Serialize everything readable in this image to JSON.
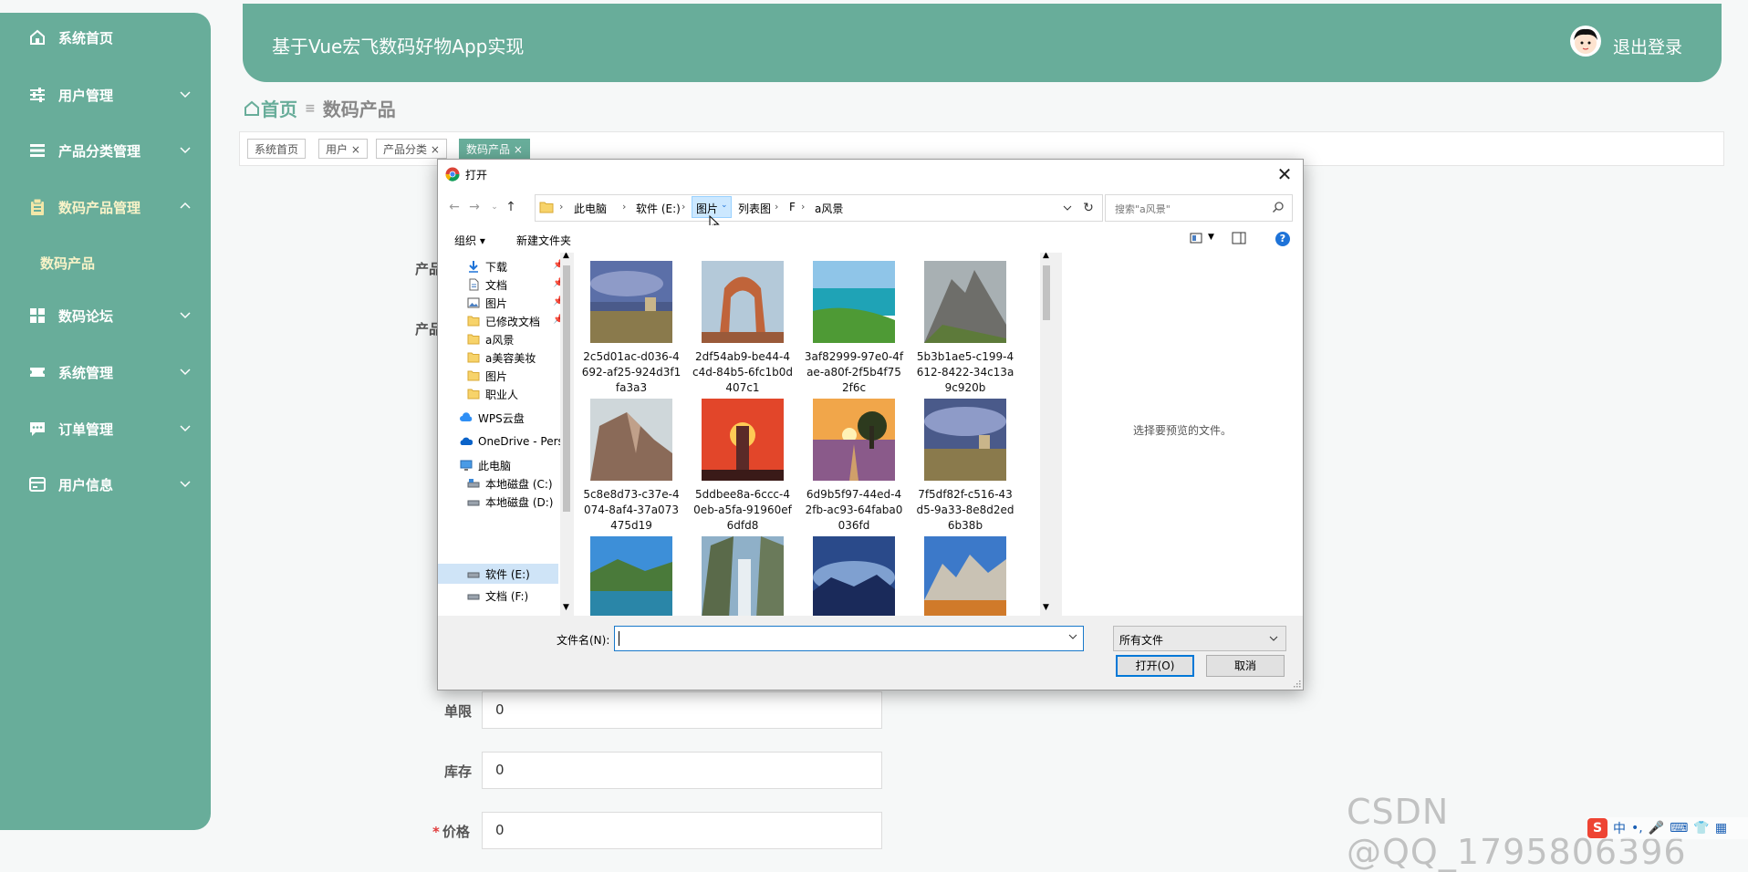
{
  "sidebar": {
    "items": [
      {
        "label": "系统首页",
        "icon": "home-icon",
        "expandable": false
      },
      {
        "label": "用户管理",
        "icon": "sliders-icon",
        "expandable": true
      },
      {
        "label": "产品分类管理",
        "icon": "list-icon",
        "expandable": true
      },
      {
        "label": "数码产品管理",
        "icon": "clipboard-icon",
        "expandable": true,
        "expanded": true
      },
      {
        "label": "数码论坛",
        "icon": "grid-icon",
        "expandable": true
      },
      {
        "label": "系统管理",
        "icon": "ticket-icon",
        "expandable": true
      },
      {
        "label": "订单管理",
        "icon": "chat-icon",
        "expandable": true
      },
      {
        "label": "用户信息",
        "icon": "card-icon",
        "expandable": true
      }
    ],
    "subitem": "数码产品"
  },
  "header": {
    "title": "基于Vue宏飞数码好物App实现",
    "logout": "退出登录"
  },
  "breadcrumb": {
    "home": "首页",
    "current": "数码产品"
  },
  "tabs": [
    {
      "label": "系统首页",
      "closable": false
    },
    {
      "label": "用户",
      "closable": true
    },
    {
      "label": "产品分类",
      "closable": true
    },
    {
      "label": "数码产品",
      "closable": true,
      "active": true
    }
  ],
  "form": {
    "partial_label_1": "产品",
    "partial_label_2": "产品",
    "fields": [
      {
        "label": "单限",
        "value": "0",
        "required": false
      },
      {
        "label": "库存",
        "value": "0",
        "required": false
      },
      {
        "label": "价格",
        "value": "0",
        "required": true
      }
    ]
  },
  "dialog": {
    "title": "打开",
    "address": [
      "此电脑",
      "软件 (E:)",
      "图片",
      "列表图",
      "F",
      "a风景"
    ],
    "search_placeholder": "搜索\"a风景\"",
    "organize": "组织",
    "new_folder": "新建文件夹",
    "tree": [
      {
        "label": "下载",
        "icon": "download-icon",
        "pinned": true
      },
      {
        "label": "文档",
        "icon": "document-icon",
        "pinned": true
      },
      {
        "label": "图片",
        "icon": "pictures-icon",
        "pinned": true
      },
      {
        "label": "已修改文档",
        "icon": "folder-icon",
        "pinned": true
      },
      {
        "label": "a风景",
        "icon": "folder-icon",
        "pinned": false
      },
      {
        "label": "a美容美妆",
        "icon": "folder-icon",
        "pinned": false
      },
      {
        "label": "图片",
        "icon": "folder-icon",
        "pinned": false
      },
      {
        "label": "职业人",
        "icon": "folder-icon",
        "pinned": false
      },
      {
        "label": "WPS云盘",
        "icon": "cloud-icon",
        "pinned": false
      },
      {
        "label": "OneDrive - Pers",
        "icon": "onedrive-icon",
        "pinned": false
      },
      {
        "label": "此电脑",
        "icon": "computer-icon",
        "pinned": false
      },
      {
        "label": "本地磁盘 (C:)",
        "icon": "drive-icon",
        "pinned": false
      },
      {
        "label": "本地磁盘 (D:)",
        "icon": "drive-icon",
        "pinned": false
      },
      {
        "label": "软件 (E:)",
        "icon": "drive-icon",
        "pinned": false,
        "selected": true
      },
      {
        "label": "文档 (F:)",
        "icon": "drive-icon",
        "pinned": false
      }
    ],
    "files": [
      {
        "name": "2c5d01ac-d036-4692-af25-924d3f1fa3a3",
        "thumb": "storm-field"
      },
      {
        "name": "2df54ab9-be44-4c4d-84b5-6fc1b0d407c1",
        "thumb": "arch"
      },
      {
        "name": "3af82999-97e0-4fae-a80f-2f5b4f752f6c",
        "thumb": "coast"
      },
      {
        "name": "5b3b1ae5-c199-4612-8422-34c13a9c920b",
        "thumb": "rocky-peak"
      },
      {
        "name": "5c8e8d73-c37e-4074-8af4-37a073475d19",
        "thumb": "cliff"
      },
      {
        "name": "5ddbee8a-6ccc-40eb-a5fa-91960ef6dfd8",
        "thumb": "sunset-tower"
      },
      {
        "name": "6d9b5f97-44ed-42fb-ac93-64faba0036fd",
        "thumb": "sunset-tree"
      },
      {
        "name": "7f5df82f-c516-43d5-9a33-8e8d2ed6b38b",
        "thumb": "storm-field"
      },
      {
        "name": "",
        "thumb": "lake"
      },
      {
        "name": "",
        "thumb": "waterfall"
      },
      {
        "name": "",
        "thumb": "sky-mountains"
      },
      {
        "name": "",
        "thumb": "dolomites"
      }
    ],
    "preview_msg": "选择要预览的文件。",
    "filename_label": "文件名(N):",
    "filename_value": "",
    "filetype": "所有文件",
    "open_btn": "打开(O)",
    "cancel_btn": "取消"
  },
  "watermark": "CSDN @QQ_1795806396",
  "ime": "中"
}
